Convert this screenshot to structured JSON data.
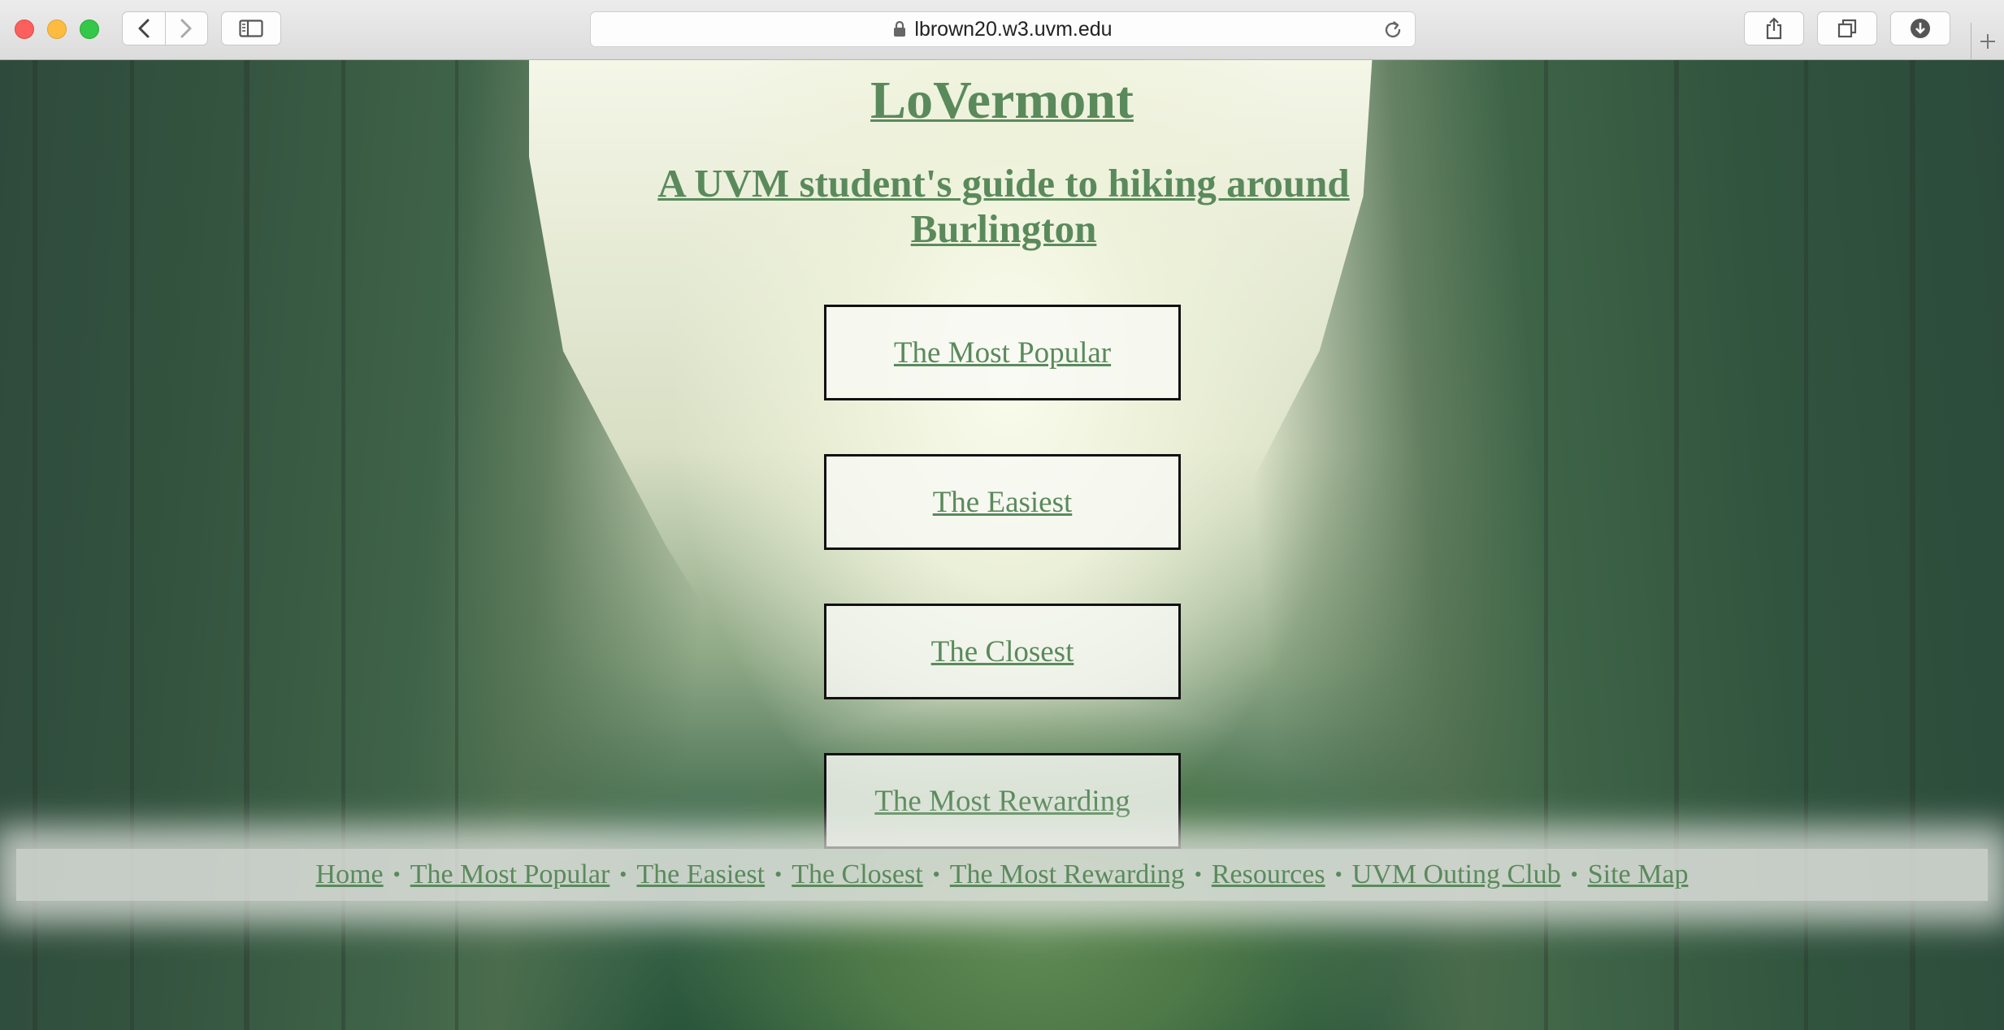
{
  "browser": {
    "url": "lbrown20.w3.uvm.edu"
  },
  "page": {
    "site_title": "LoVermont",
    "subtitle": "A UVM student's guide to hiking around Burlington",
    "buttons": [
      {
        "label": "The Most Popular"
      },
      {
        "label": "The Easiest"
      },
      {
        "label": "The Closest"
      },
      {
        "label": "The Most Rewarding"
      }
    ],
    "footer_nav": {
      "separator": "•",
      "items": [
        {
          "label": "Home"
        },
        {
          "label": "The Most Popular"
        },
        {
          "label": "The Easiest"
        },
        {
          "label": "The Closest"
        },
        {
          "label": "The Most Rewarding"
        },
        {
          "label": "Resources"
        },
        {
          "label": "UVM Outing Club"
        },
        {
          "label": "Site Map"
        }
      ]
    }
  },
  "colors": {
    "link_green": "#5a8a5c",
    "button_border": "#111111"
  },
  "icons": [
    "back-icon",
    "forward-icon",
    "sidebar-icon",
    "lock-icon",
    "reload-icon",
    "share-icon",
    "tabs-icon",
    "download-icon",
    "new-tab-icon"
  ]
}
